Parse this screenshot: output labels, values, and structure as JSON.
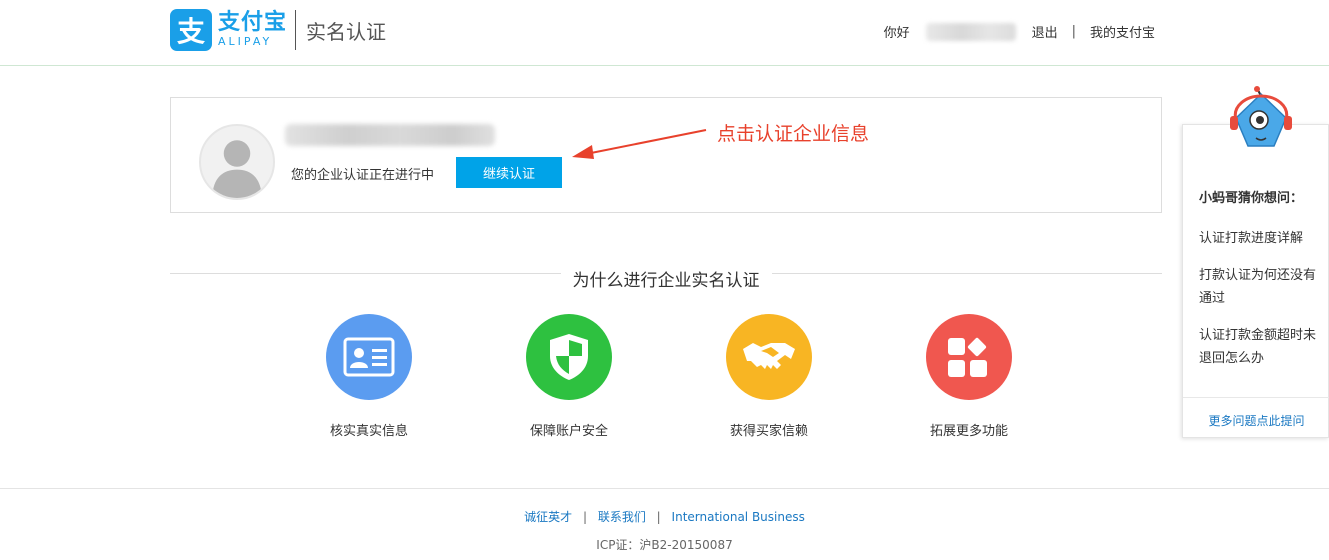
{
  "header": {
    "logo_char": "支",
    "logo_cn": "支付宝",
    "logo_en": "ALIPAY",
    "page_title": "实名认证",
    "greeting": "你好",
    "logout": "退出",
    "separator": "|",
    "my_alipay": "我的支付宝"
  },
  "status": {
    "message": "您的企业认证正在进行中",
    "continue_label": "继续认证"
  },
  "annotation": {
    "text": "点击认证企业信息",
    "color": "#e8412c"
  },
  "why": {
    "title": "为什么进行企业实名认证",
    "features": [
      {
        "label": "核实真实信息",
        "icon": "id-card-icon",
        "color": "#5b9cf0"
      },
      {
        "label": "保障账户安全",
        "icon": "shield-icon",
        "color": "#2ec140"
      },
      {
        "label": "获得买家信赖",
        "icon": "handshake-icon",
        "color": "#f8b523"
      },
      {
        "label": "拓展更多功能",
        "icon": "apps-grid-icon",
        "color": "#f0574f"
      }
    ]
  },
  "helper": {
    "title": "小蚂哥猜你想问：",
    "questions": [
      "认证打款进度详解",
      "打款认证为何还没有通过",
      "认证打款金额超时未退回怎么办"
    ],
    "more": "更多问题点此提问"
  },
  "footer": {
    "links": [
      "诚征英才",
      "联系我们",
      "International Business"
    ],
    "separator": "|",
    "icp": "ICP证：沪B2-20150087"
  },
  "colors": {
    "brand": "#1a9fe8",
    "button": "#00a3e8",
    "link": "#1a78c2"
  }
}
